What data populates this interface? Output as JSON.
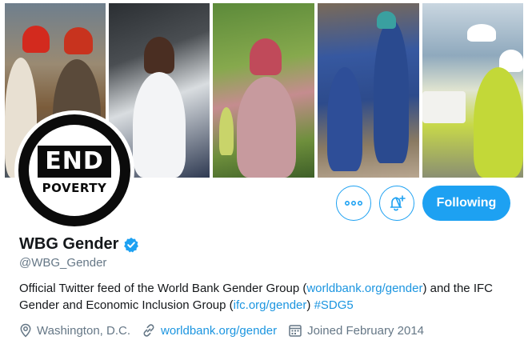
{
  "profile": {
    "name": "WBG Gender",
    "handle": "@WBG_Gender",
    "verified": true,
    "avatar": {
      "line1": "END",
      "line2": "POVERTY"
    },
    "bio": {
      "text1": "Official Twitter feed of the World Bank Gender Group (",
      "link1": "worldbank.org/gender",
      "text2": ") and the IFC Gender and Economic Inclusion Group (",
      "link2": "ifc.org/gender",
      "text3": ") ",
      "hashtag": "#SDG5"
    },
    "location": "Washington, D.C.",
    "website": "worldbank.org/gender",
    "joined": "Joined February 2014"
  },
  "actions": {
    "more_icon": "more-icon",
    "notify_icon": "bell-plus-icon",
    "follow_label": "Following"
  },
  "colors": {
    "accent": "#1da1f2",
    "link": "#1b95e0",
    "muted": "#657786",
    "text": "#14171a"
  }
}
